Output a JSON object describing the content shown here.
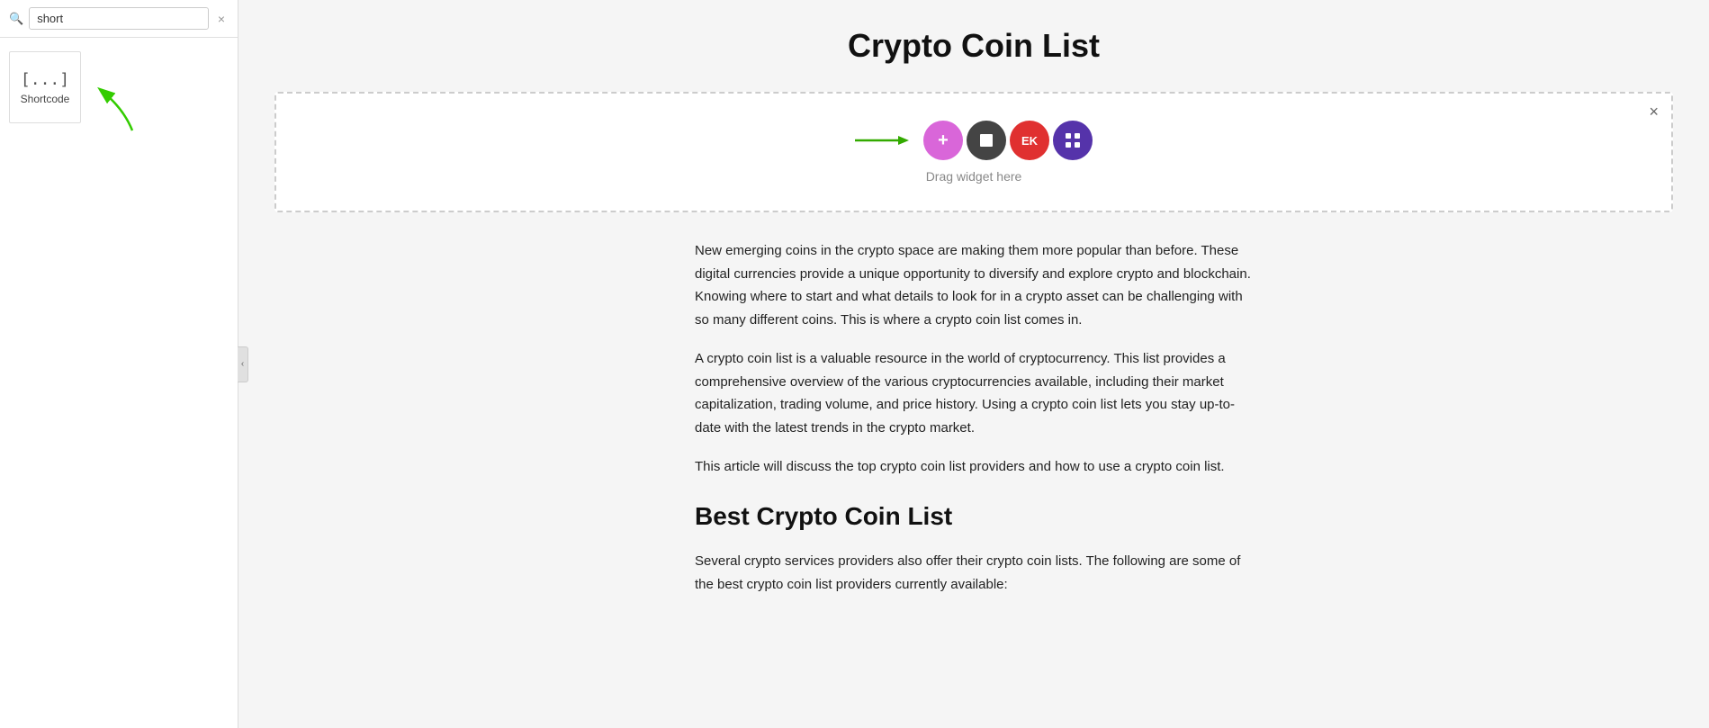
{
  "sidebar": {
    "search": {
      "value": "short",
      "placeholder": "Search...",
      "clear_label": "×"
    },
    "widgets": [
      {
        "id": "shortcode",
        "code_label": "[...]",
        "label": "Shortcode"
      }
    ]
  },
  "collapse_handle": {
    "icon": "‹"
  },
  "main": {
    "page_title": "Crypto Coin List",
    "drop_zone": {
      "label": "Drag widget here",
      "close_label": "×",
      "icons": [
        {
          "id": "plus",
          "symbol": "+",
          "color_class": "wc-pink"
        },
        {
          "id": "square",
          "symbol": "■",
          "color_class": "wc-dark"
        },
        {
          "id": "ek",
          "symbol": "EK",
          "color_class": "wc-red"
        },
        {
          "id": "grid",
          "symbol": "⊞",
          "color_class": "wc-purple"
        }
      ]
    },
    "article": {
      "paragraphs": [
        "New emerging coins in the crypto space are making them more popular than before. These digital currencies provide a unique opportunity to diversify and explore crypto and blockchain. Knowing where to start and what details to look for in a crypto asset can be challenging with so many different coins. This is where a crypto coin list comes in.",
        "A crypto coin list is a valuable resource in the world of cryptocurrency. This list provides a comprehensive overview of the various cryptocurrencies available, including their market capitalization, trading volume, and price history. Using a crypto coin list lets you stay up-to-date with the latest trends in the crypto market.",
        "This article will discuss the top crypto coin list providers and how to use a crypto coin list."
      ],
      "subheading": "Best Crypto Coin List",
      "subheading_para": "Several crypto services providers also offer their crypto coin lists. The following are some of the best crypto coin list providers currently available:"
    }
  }
}
